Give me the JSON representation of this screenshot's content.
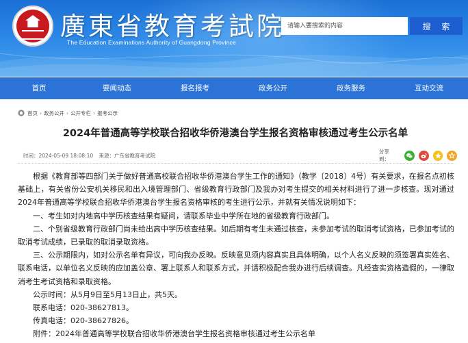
{
  "header": {
    "site_title": "廣東省教育考試院",
    "site_subtitle": "The Education Examinations Authority of Guangdong Province",
    "search": {
      "placeholder": "请输入要搜索的内容",
      "button_label": "搜 索"
    },
    "logo_text": "考试院"
  },
  "nav": {
    "items": [
      "首页",
      "要闻动态",
      "报名报考",
      "政务公开",
      "政务服务",
      "互动交流"
    ]
  },
  "breadcrumb": {
    "items": [
      "首页",
      "政务公开",
      "公开专栏",
      "报考公示"
    ],
    "separator": "›"
  },
  "article": {
    "title": "2024年普通高等学校联合招收华侨港澳台学生报名资格审核通过考生公示名单",
    "publish_time": "时间：2024-05-09 18:08:10",
    "source": "来源：广东省教育考试院",
    "share_label": "分享到：",
    "share_icons": [
      {
        "name": "wechat-share-icon",
        "color": "#3cb034"
      },
      {
        "name": "weibo-share-icon",
        "color": "#e0483d"
      },
      {
        "name": "qzone-share-icon",
        "color": "#f4c21b"
      },
      {
        "name": "favorite-share-icon",
        "color": "#f1a427"
      }
    ],
    "paragraphs": [
      "根据《教育部等四部门关于做好普通高校联合招收华侨港澳台学生工作的通知》（教学〔2018〕4号）有关要求，在报名点初核基础上，有关省份公安机关移民和出入境管理部门、省级教育行政部门及我办对考生提交的相关材料进行了进一步核查。现对通过2024年普通高等学校联合招收华侨港澳台学生报名资格审核的考生进行公示，并就有关情况说明如下：",
      "一、考生如对内地高中学历核查结果有疑问，请联系毕业中学所在地的省级教育行政部门。",
      "二、个别省级教育行政部门尚未给出高中学历核查结果。如后期有考生未通过核查，未参加考试的取消考试资格，已参加考试的取消考试成绩，已录取的取消录取资格。",
      "三、公示期限内，如对公示名单有异议，可向我办反映。反映意见须内容真实且具体明确，以个人名义反映的须签署真实姓名、联系电话，以单位名义反映的应加盖公章、署上联系人和联系方式，并请积极配合我办进行后续调查。凡经查实资格造假的，一律取消考生考试资格和录取资格。",
      "公示时间：从5月9日至5月13日止，共5天。",
      "联系电话：020-38627813。",
      "传真电话：020-38627826。"
    ],
    "attachment": "附件：2024年普通高等学校联合招收华侨港澳台学生报名资格审核通过考生公示名单"
  },
  "colors": {
    "header_gradient_top": "#1a6fd4",
    "nav_background": "#2b73d6",
    "search_button": "#1d5fd0",
    "logo_red": "#c8191f"
  }
}
